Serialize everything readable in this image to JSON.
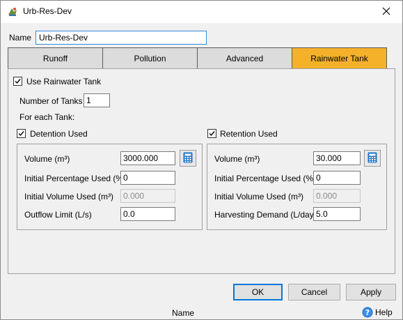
{
  "window": {
    "title": "Urb-Res-Dev",
    "icon": "app-icon",
    "close_icon": "close-icon"
  },
  "name": {
    "label": "Name",
    "value": "Urb-Res-Dev"
  },
  "tabs": [
    {
      "label": "Runoff",
      "active": false
    },
    {
      "label": "Pollution",
      "active": false
    },
    {
      "label": "Advanced",
      "active": false
    },
    {
      "label": "Rainwater Tank",
      "active": true
    }
  ],
  "colors": {
    "active_tab": "#f5b12a",
    "focus_border": "#2f8ad9",
    "calc_icon": "#1e74c6"
  },
  "tank": {
    "use_label": "Use Rainwater Tank",
    "use_checked": true,
    "number_label": "Number of Tanks",
    "number_value": "1",
    "for_each_label": "For each Tank:"
  },
  "detention": {
    "checkbox_label": "Detention Used",
    "checked": true,
    "volume_label": "Volume (m³)",
    "volume_value": "3000.000",
    "initial_pct_label": "Initial Percentage Used (%)",
    "initial_pct_value": "0",
    "initial_vol_label": "Initial Volume Used (m³)",
    "initial_vol_value": "0.000",
    "outflow_label": "Outflow Limit (L/s)",
    "outflow_value": "0.0"
  },
  "retention": {
    "checkbox_label": "Retention Used",
    "checked": true,
    "volume_label": "Volume (m³)",
    "volume_value": "30.000",
    "initial_pct_label": "Initial Percentage Used (%)",
    "initial_pct_value": "0",
    "initial_vol_label": "Initial Volume Used (m³)",
    "initial_vol_value": "0.000",
    "demand_label": "Harvesting Demand (L/day)",
    "demand_value": "5.0"
  },
  "buttons": {
    "ok": "OK",
    "cancel": "Cancel",
    "apply": "Apply"
  },
  "status": {
    "text": "Name",
    "help": "Help"
  }
}
